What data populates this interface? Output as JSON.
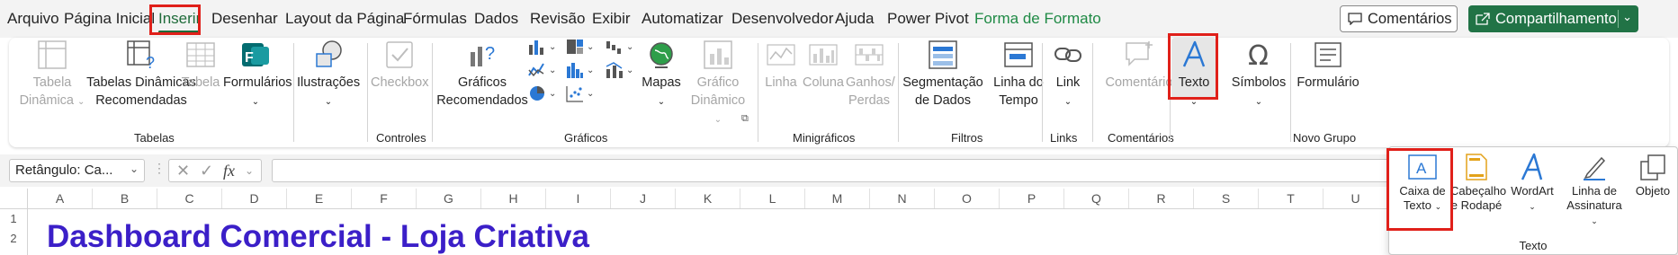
{
  "menu": {
    "items": [
      "Arquivo",
      "Página Inicial",
      "Inserir",
      "Desenhar",
      "Layout da Página",
      "Fórmulas",
      "Dados",
      "Revisão",
      "Exibir",
      "Automatizar",
      "Desenvolvedor",
      "Ajuda",
      "Power Pivot",
      "Forma de Formato"
    ],
    "active": "Inserir",
    "comments_label": "Comentários",
    "share_label": "Compartilhamento"
  },
  "ribbon": {
    "groups": {
      "tabelas": "Tabelas",
      "controles": "Controles",
      "graficos": "Gráficos",
      "minigraficos": "Minigráficos",
      "filtros": "Filtros",
      "links": "Links",
      "comentarios": "Comentários",
      "novo_grupo": "Novo Grupo"
    },
    "buttons": {
      "tabela_dinamica": [
        "Tabela",
        "Dinâmica"
      ],
      "tabelas_dinamicas_rec": [
        "Tabelas Dinâmicas",
        "Recomendadas"
      ],
      "tabela": "Tabela",
      "formularios": "Formulários",
      "ilustracoes": "Ilustrações",
      "checkbox": "Checkbox",
      "graficos_rec": [
        "Gráficos",
        "Recomendados"
      ],
      "mapas": "Mapas",
      "grafico_dinamico": [
        "Gráfico",
        "Dinâmico"
      ],
      "linha": "Linha",
      "coluna": "Coluna",
      "ganhos_perdas": [
        "Ganhos/",
        "Perdas"
      ],
      "segmentacao": [
        "Segmentação",
        "de Dados"
      ],
      "linha_tempo": [
        "Linha do",
        "Tempo"
      ],
      "link": "Link",
      "comentario": "Comentário",
      "texto": "Texto",
      "simbolos": "Símbolos",
      "formulario": "Formulário"
    }
  },
  "formula_bar": {
    "name_box": "Retângulo: Ca...",
    "fx": "fx"
  },
  "grid": {
    "columns": [
      "A",
      "B",
      "C",
      "D",
      "E",
      "F",
      "G",
      "H",
      "I",
      "J",
      "K",
      "L",
      "M",
      "N",
      "O",
      "P",
      "Q",
      "R",
      "S",
      "T",
      "U"
    ],
    "rows": [
      "1",
      "2"
    ],
    "title_text": "Dashboard Comercial - Loja Criativa"
  },
  "dropdown": {
    "items": {
      "caixa_texto": [
        "Caixa de",
        "Texto"
      ],
      "cabecalho": [
        "Cabeçalho",
        "e Rodapé"
      ],
      "wordart": "WordArt",
      "linha_assinatura": [
        "Linha de",
        "Assinatura"
      ],
      "objeto": "Objeto"
    },
    "group_label": "Texto"
  },
  "colors": {
    "accent_green": "#217346",
    "highlight_red": "#e0201a",
    "title_purple": "#3b1fc8",
    "icon_blue": "#2b78d4"
  }
}
